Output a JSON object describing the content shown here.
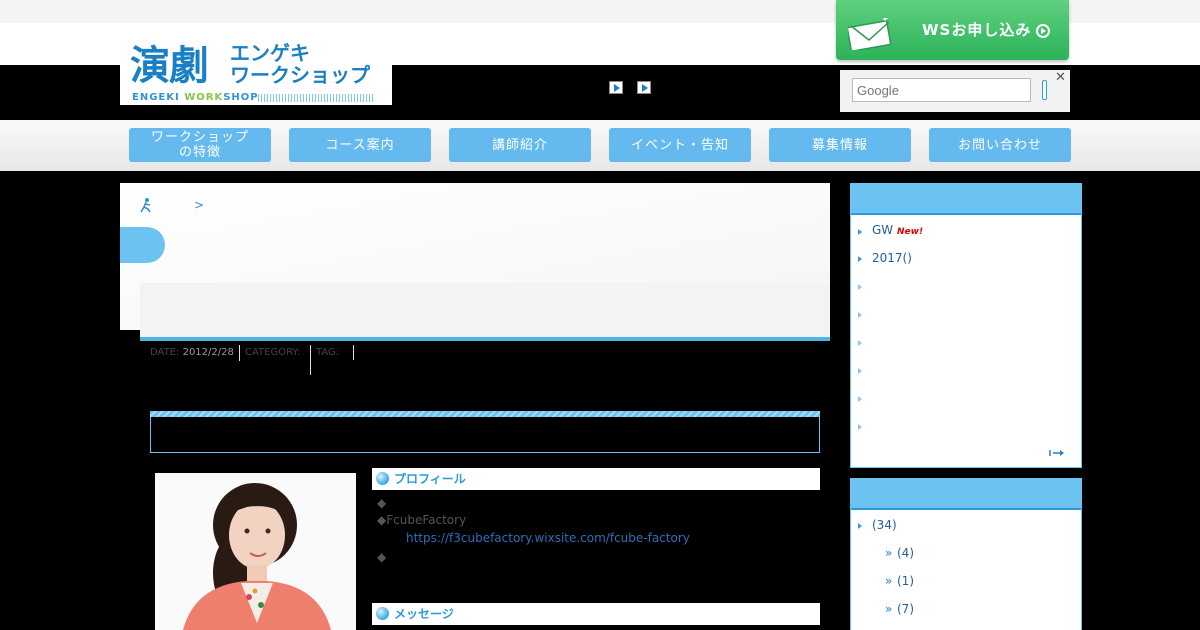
{
  "header": {
    "logo": {
      "kanji": "演劇",
      "kana_line1": "エンゲキ",
      "kana_line2": "ワークショップ",
      "sub_a": "ENGEKI ",
      "sub_b": "WORK",
      "sub_c": "SHOP"
    },
    "cta_button": {
      "label": "WSお申し込み",
      "icons": [
        "envelope-icon",
        "arrow-circle-icon"
      ]
    },
    "search": {
      "placeholder": "Google"
    },
    "close_label": "✕"
  },
  "nav": {
    "items": [
      {
        "label": "ワークショップ\nの特徴"
      },
      {
        "label": "コース案内"
      },
      {
        "label": "講師紹介"
      },
      {
        "label": "イベント・告知"
      },
      {
        "label": "募集情報"
      },
      {
        "label": "お問い合わせ"
      }
    ]
  },
  "breadcrumb": {
    "separator": ">"
  },
  "post_meta": {
    "date_label": "DATE:",
    "date_value": "2012/2/28",
    "category_label": "CATEGORY:",
    "tag_label": "TAG:"
  },
  "profile": {
    "heading": "プロフィール",
    "lines": [
      "◆",
      "◆FcubeFactory",
      "◆"
    ],
    "url": "https://f3cubefactory.wixsite.com/fcube-factory"
  },
  "message": {
    "heading": "メッセージ"
  },
  "sidebar": {
    "box1": {
      "items": [
        {
          "text": "GW",
          "badge": "New!"
        },
        {
          "text": "2017()"
        }
      ]
    },
    "box2": {
      "items": [
        {
          "text": "(34)"
        },
        {
          "text": "(4)"
        },
        {
          "text": "(1)"
        },
        {
          "text": "(7)"
        }
      ]
    }
  }
}
